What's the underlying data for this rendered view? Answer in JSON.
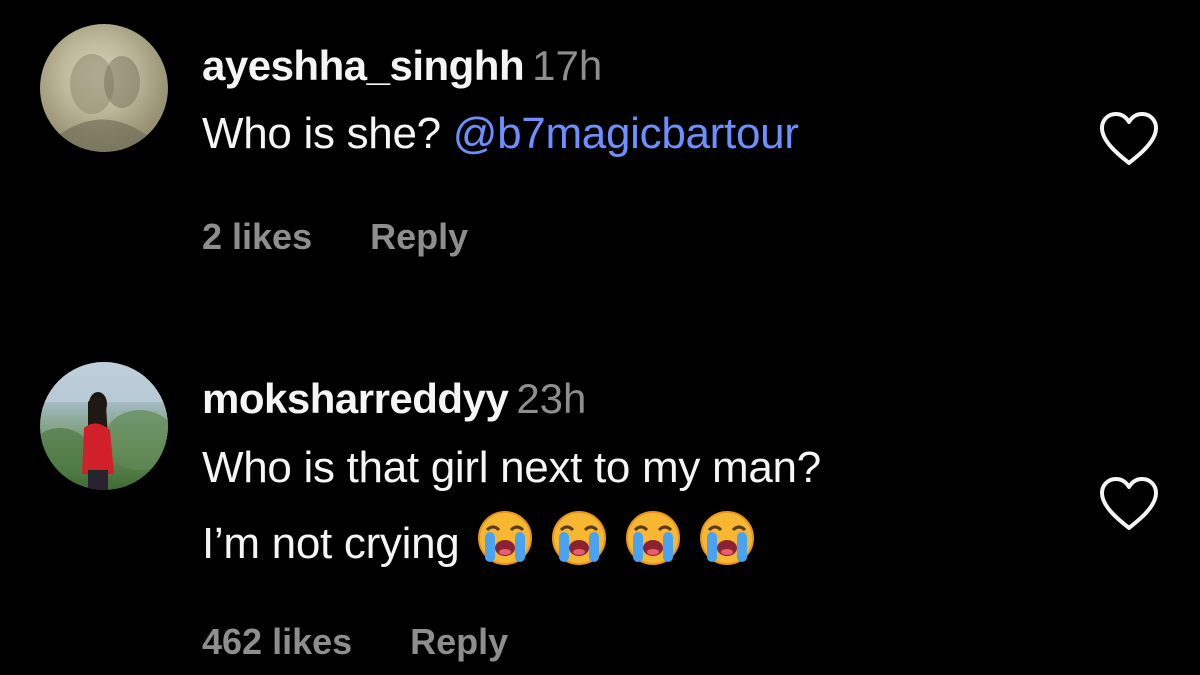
{
  "comments": [
    {
      "username": "ayeshha_singhh",
      "timestamp": "17h",
      "text": "Who is she?",
      "mention": "@b7magicbartour",
      "likes": "2 likes",
      "reply_label": "Reply",
      "avatar_icon": "profile-photo",
      "like_icon": "heart-outline-icon"
    },
    {
      "username": "moksharreddyy",
      "timestamp": "23h",
      "text_line1": "Who is that girl next to my man?",
      "text_line2": "I’m not crying",
      "emojis": [
        "loudly-crying-face",
        "loudly-crying-face",
        "loudly-crying-face",
        "loudly-crying-face"
      ],
      "likes": "462 likes",
      "reply_label": "Reply",
      "avatar_icon": "profile-photo",
      "like_icon": "heart-outline-icon"
    }
  ],
  "colors": {
    "background": "#000000",
    "primary_text": "#f5f5f5",
    "secondary_text": "#8e8e8e",
    "mention": "#6d8fff"
  }
}
